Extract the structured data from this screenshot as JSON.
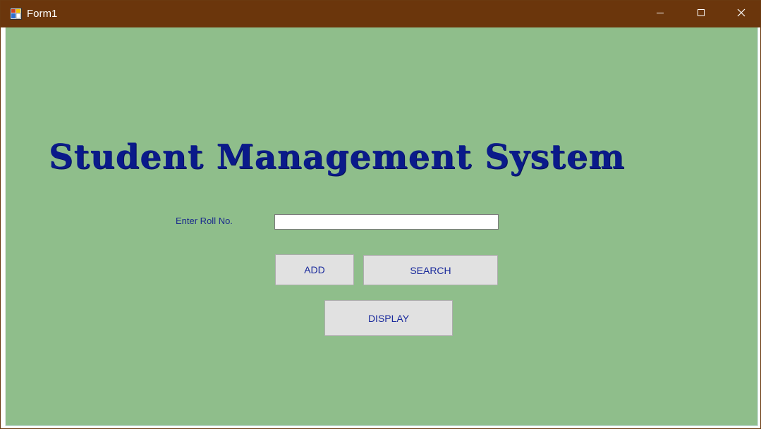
{
  "window": {
    "title": "Form1",
    "app_icon": "form-app-icon",
    "controls": {
      "minimize_icon": "minimize-icon",
      "maximize_icon": "maximize-icon",
      "close_icon": "close-icon"
    },
    "colors": {
      "titlebar": "#6b360c",
      "client_background": "#8fbe8b",
      "heading_text": "#0a1a8a",
      "button_text": "#1a2a9c",
      "button_face": "#e1e1e1"
    }
  },
  "form": {
    "heading": "Student Management System",
    "roll_label": "Enter Roll No.",
    "roll_value": "",
    "add_label": "ADD",
    "search_label": "SEARCH",
    "display_label": "DISPLAY"
  }
}
